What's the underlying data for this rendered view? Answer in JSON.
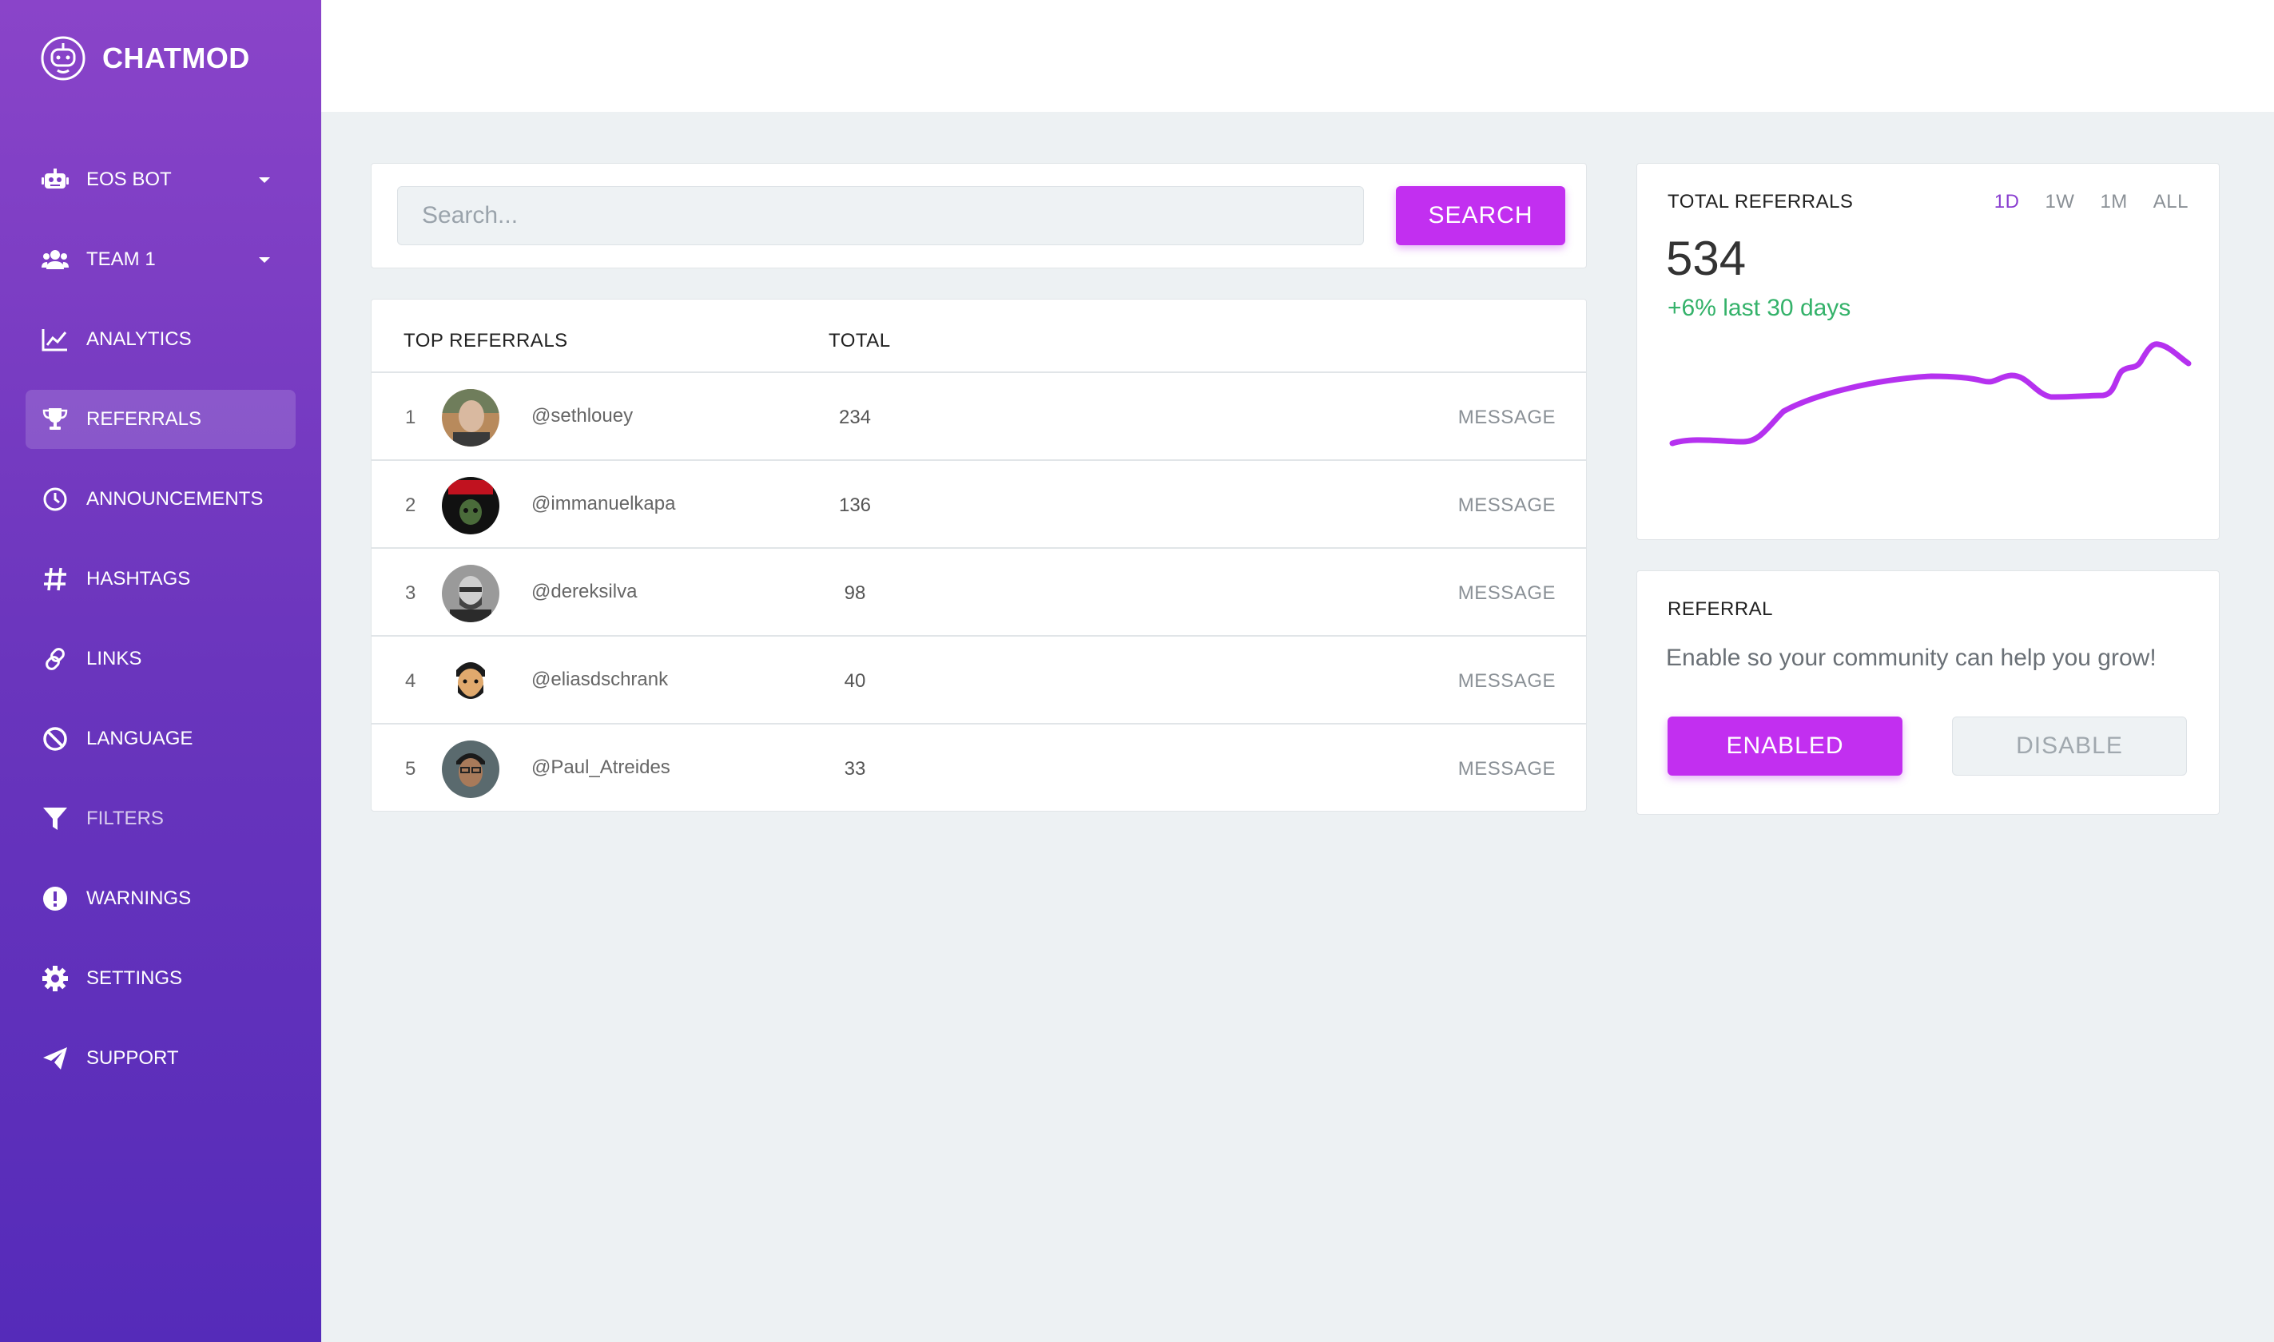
{
  "brand": {
    "name": "CHATMOD",
    "icon": "robot-face-icon"
  },
  "sidebar": {
    "items": [
      {
        "label": "EOS BOT",
        "icon": "robot-icon",
        "dropdown": true
      },
      {
        "label": "TEAM 1",
        "icon": "users-icon",
        "dropdown": true
      },
      {
        "label": "ANALYTICS",
        "icon": "chart-line-icon"
      },
      {
        "label": "REFERRALS",
        "icon": "trophy-icon",
        "active": true
      },
      {
        "label": "ANNOUNCEMENTS",
        "icon": "clock-icon"
      },
      {
        "label": "HASHTAGS",
        "icon": "hashtag-icon"
      },
      {
        "label": "LINKS",
        "icon": "link-icon"
      },
      {
        "label": "LANGUAGE",
        "icon": "ban-icon"
      },
      {
        "label": "FILTERS",
        "icon": "filter-icon"
      },
      {
        "label": "WARNINGS",
        "icon": "exclamation-icon"
      },
      {
        "label": "SETTINGS",
        "icon": "gear-icon"
      },
      {
        "label": "SUPPORT",
        "icon": "paper-plane-icon"
      }
    ]
  },
  "search": {
    "placeholder": "Search...",
    "button_label": "SEARCH"
  },
  "referrals_table": {
    "headers": {
      "name": "TOP REFERRALS",
      "total": "TOTAL"
    },
    "message_label": "MESSAGE",
    "rows": [
      {
        "rank": "1",
        "user": "@sethlouey",
        "total": "234"
      },
      {
        "rank": "2",
        "user": "@immanuelkapa",
        "total": "136"
      },
      {
        "rank": "3",
        "user": "@dereksilva",
        "total": "98"
      },
      {
        "rank": "4",
        "user": "@eliasdschrank",
        "total": "40"
      },
      {
        "rank": "5",
        "user": "@Paul_Atreides",
        "total": "33"
      }
    ]
  },
  "stats": {
    "title": "TOTAL REFERRALS",
    "value": "534",
    "change": "+6% last 30 days",
    "ranges": [
      "1D",
      "1W",
      "1M",
      "ALL"
    ],
    "active_range": "1D",
    "line_color": "#b531ef"
  },
  "referral_settings": {
    "title": "REFERRAL",
    "description": "Enable so your community can help you grow!",
    "enabled_label": "ENABLED",
    "disable_label": "DISABLE"
  },
  "colors": {
    "accent": "#c22ff0",
    "positive": "#34b26a"
  }
}
